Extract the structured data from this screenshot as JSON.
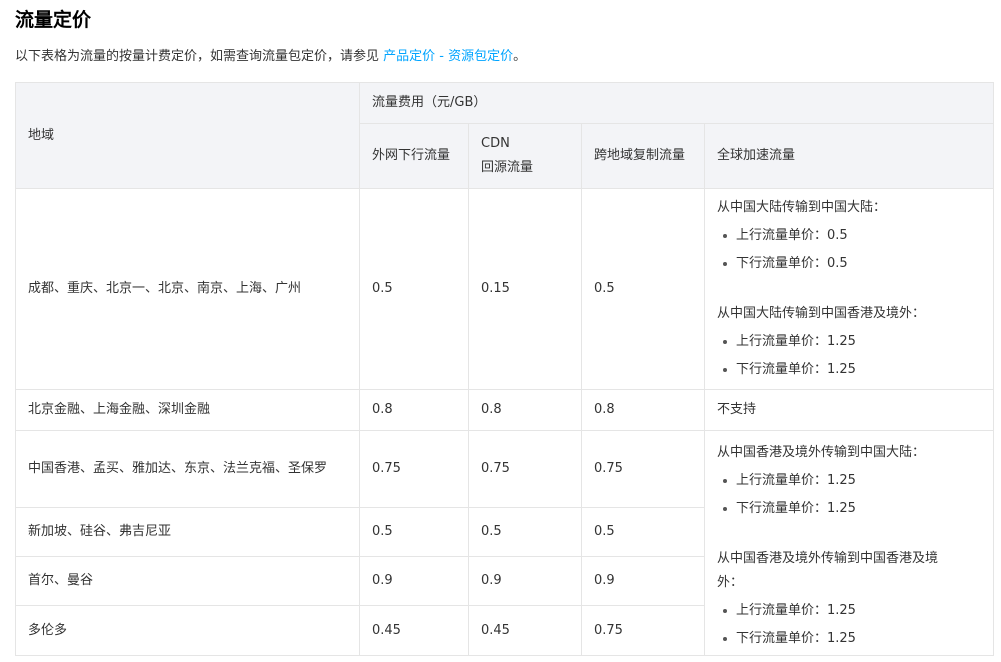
{
  "title": "流量定价",
  "intro": {
    "text": "以下表格为流量的按量计费定价，如需查询流量包定价，请参见 ",
    "link": "产品定价 - 资源包定价",
    "end": "。"
  },
  "table": {
    "region_header": "地域",
    "fee_header": "流量费用（元/GB）",
    "col_internet": "外网下行流量",
    "col_cdn_l1": "CDN",
    "col_cdn_l2": "回源流量",
    "col_cross": "跨地域复制流量",
    "col_global": "全球加速流量",
    "rows": [
      {
        "region": "成都、重庆、北京一、北京、南京、上海、广州",
        "internet": "0.5",
        "cdn": "0.15",
        "cross": "0.5"
      },
      {
        "region": "北京金融、上海金融、深圳金融",
        "internet": "0.8",
        "cdn": "0.8",
        "cross": "0.8",
        "global": "不支持"
      },
      {
        "region": "中国香港、孟买、雅加达、东京、法兰克福、圣保罗",
        "internet": "0.75",
        "cdn": "0.75",
        "cross": "0.75"
      },
      {
        "region": "新加坡、硅谷、弗吉尼亚",
        "internet": "0.5",
        "cdn": "0.5",
        "cross": "0.5"
      },
      {
        "region": "首尔、曼谷",
        "internet": "0.9",
        "cdn": "0.9",
        "cross": "0.9"
      },
      {
        "region": "多伦多",
        "internet": "0.45",
        "cdn": "0.45",
        "cross": "0.75"
      }
    ],
    "global_mainland": {
      "to_mainland": {
        "title": "从中国大陆传输到中国大陆：",
        "up": "上行流量单价：0.5",
        "down": "下行流量单价：0.5"
      },
      "to_overseas": {
        "title": "从中国大陆传输到中国香港及境外：",
        "up": "上行流量单价：1.25",
        "down": "下行流量单价：1.25"
      }
    },
    "global_overseas": {
      "to_mainland": {
        "title": "从中国香港及境外传输到中国大陆：",
        "up": "上行流量单价：1.25",
        "down": "下行流量单价：1.25"
      },
      "to_overseas": {
        "title": "从中国香港及境外传输到中国香港及境外：",
        "up": "上行流量单价：1.25",
        "down": "下行流量单价：1.25"
      }
    }
  }
}
